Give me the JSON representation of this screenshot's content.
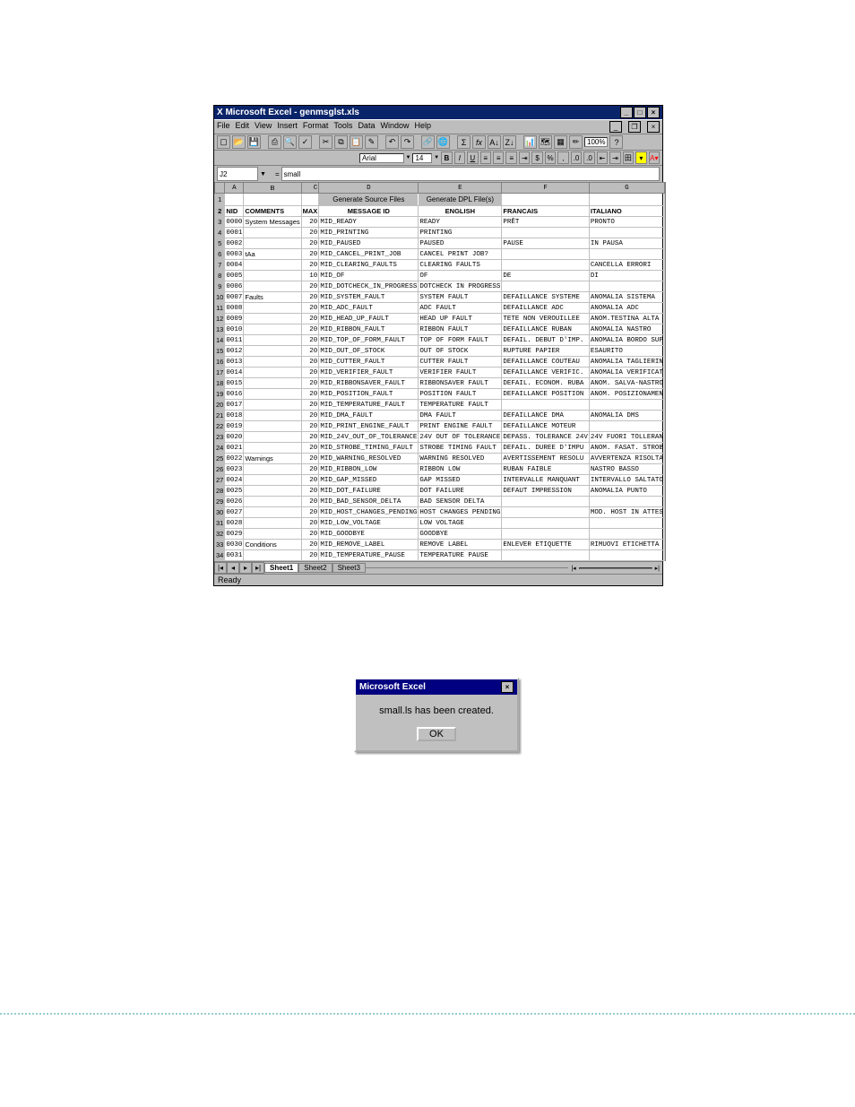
{
  "title": "Microsoft Excel - genmsglst.xls",
  "menus": [
    "File",
    "Edit",
    "View",
    "Insert",
    "Format",
    "Tools",
    "Data",
    "Window",
    "Help"
  ],
  "zoom": "100%",
  "fontname": "Arial",
  "fontsize": "14",
  "namebox": "J2",
  "formula": "small",
  "buttons": {
    "gensrc": "Generate Source Files",
    "gendpl": "Generate DPL File(s)"
  },
  "headers": {
    "nid": "NID",
    "comments": "COMMENTS",
    "max": "MAX",
    "msgid": "MESSAGE ID",
    "eng": "ENGLISH",
    "fra": "FRANCAIS",
    "ita": "ITALIANO"
  },
  "colHeaders": [
    "A",
    "B",
    "C",
    "D",
    "E",
    "F",
    "G"
  ],
  "rows": [
    {
      "n": 3,
      "a": "0000",
      "b": "System Messages",
      "c": "20",
      "d": "MID_READY",
      "e": "READY",
      "f": "PRÊT",
      "g": "PRONTO"
    },
    {
      "n": 4,
      "a": "0001",
      "b": "",
      "c": "20",
      "d": "MID_PRINTING",
      "e": "PRINTING",
      "f": "",
      "g": ""
    },
    {
      "n": 5,
      "a": "0002",
      "b": "",
      "c": "20",
      "d": "MID_PAUSED",
      "e": "PAUSED",
      "f": "PAUSE",
      "g": "IN PAUSA"
    },
    {
      "n": 6,
      "a": "0003",
      "b": "tAa",
      "c": "20",
      "d": "MID_CANCEL_PRINT_JOB",
      "e": "CANCEL PRINT JOB?",
      "f": "",
      "g": ""
    },
    {
      "n": 7,
      "a": "0004",
      "b": "",
      "c": "20",
      "d": "MID_CLEARING_FAULTS",
      "e": "CLEARING FAULTS",
      "f": "",
      "g": "CANCELLA ERRORI"
    },
    {
      "n": 8,
      "a": "0005",
      "b": "",
      "c": "10",
      "d": "MID_OF",
      "e": "OF",
      "f": "DE",
      "g": "DI"
    },
    {
      "n": 9,
      "a": "0006",
      "b": "",
      "c": "20",
      "d": "MID_DOTCHECK_IN_PROGRESS",
      "e": "DOTCHECK IN PROGRESS",
      "f": "",
      "g": ""
    },
    {
      "n": 10,
      "a": "0007",
      "b": "Faults",
      "c": "20",
      "d": "MID_SYSTEM_FAULT",
      "e": "SYSTEM FAULT",
      "f": "DEFAILLANCE SYSTEME",
      "g": "ANOMALIA SISTEMA"
    },
    {
      "n": 11,
      "a": "0008",
      "b": "",
      "c": "20",
      "d": "MID_ADC_FAULT",
      "e": "ADC FAULT",
      "f": "DEFAILLANCE ADC",
      "g": "ANOMALIA ADC"
    },
    {
      "n": 12,
      "a": "0009",
      "b": "",
      "c": "20",
      "d": "MID_HEAD_UP_FAULT",
      "e": "HEAD UP FAULT",
      "f": "TETE NON VEROUILLEE",
      "g": "ANOM.TESTINA ALTA"
    },
    {
      "n": 13,
      "a": "0010",
      "b": "",
      "c": "20",
      "d": "MID_RIBBON_FAULT",
      "e": "RIBBON FAULT",
      "f": "DEFAILLANCE RUBAN",
      "g": "ANOMALIA NASTRO"
    },
    {
      "n": 14,
      "a": "0011",
      "b": "",
      "c": "20",
      "d": "MID_TOP_OF_FORM_FAULT",
      "e": "TOP OF FORM FAULT",
      "f": "DEFAIL. DEBUT D'IMP.",
      "g": "ANOMALIA BORDO SUP"
    },
    {
      "n": 15,
      "a": "0012",
      "b": "",
      "c": "20",
      "d": "MID_OUT_OF_STOCK",
      "e": "OUT OF STOCK",
      "f": "RUPTURE PAPIER",
      "g": "ESAURITO"
    },
    {
      "n": 16,
      "a": "0013",
      "b": "",
      "c": "20",
      "d": "MID_CUTTER_FAULT",
      "e": "CUTTER FAULT",
      "f": "DEFAILLANCE COUTEAU",
      "g": "ANOMALIA TAGLIERIN"
    },
    {
      "n": 17,
      "a": "0014",
      "b": "",
      "c": "20",
      "d": "MID_VERIFIER_FAULT",
      "e": "VERIFIER FAULT",
      "f": "DEFAILLANCE VERIFIC.",
      "g": "ANOMALIA VERIFICAT"
    },
    {
      "n": 18,
      "a": "0015",
      "b": "",
      "c": "20",
      "d": "MID_RIBBONSAVER_FAULT",
      "e": "RIBBONSAVER FAULT",
      "f": "DEFAIL. ECONOM. RUBA",
      "g": "ANOM. SALVA-NASTRO"
    },
    {
      "n": 19,
      "a": "0016",
      "b": "",
      "c": "20",
      "d": "MID_POSITION_FAULT",
      "e": "POSITION FAULT",
      "f": "DEFAILLANCE POSITION",
      "g": "ANOM. POSIZIONAMEN"
    },
    {
      "n": 20,
      "a": "0017",
      "b": "",
      "c": "20",
      "d": "MID_TEMPERATURE_FAULT",
      "e": "TEMPERATURE FAULT",
      "f": "",
      "g": ""
    },
    {
      "n": 21,
      "a": "0018",
      "b": "",
      "c": "20",
      "d": "MID_DMA_FAULT",
      "e": "DMA FAULT",
      "f": "DEFAILLANCE DMA",
      "g": "ANOMALIA DMS"
    },
    {
      "n": 22,
      "a": "0019",
      "b": "",
      "c": "20",
      "d": "MID_PRINT_ENGINE_FAULT",
      "e": "PRINT ENGINE FAULT",
      "f": "DEFAILLANCE MOTEUR",
      "g": ""
    },
    {
      "n": 23,
      "a": "0020",
      "b": "",
      "c": "20",
      "d": "MID_24V_OUT_OF_TOLERANCE",
      "e": "24V OUT OF TOLERANCE",
      "f": "DEPASS. TOLERANCE 24V",
      "g": "24V FUORI TOLLERAN"
    },
    {
      "n": 24,
      "a": "0021",
      "b": "",
      "c": "20",
      "d": "MID_STROBE_TIMING_FAULT",
      "e": "STROBE TIMING FAULT",
      "f": "DEFAIL. DUREE D'IMPU",
      "g": "ANOM. FASAT. STROB"
    },
    {
      "n": 25,
      "a": "0022",
      "b": "Warnings",
      "c": "20",
      "d": "MID_WARNING_RESOLVED",
      "e": "WARNING RESOLVED",
      "f": "AVERTISSEMENT RESOLU",
      "g": "AVVERTENZA RISOLTA"
    },
    {
      "n": 26,
      "a": "0023",
      "b": "",
      "c": "20",
      "d": "MID_RIBBON_LOW",
      "e": "RIBBON LOW",
      "f": "RUBAN FAIBLE",
      "g": "NASTRO BASSO"
    },
    {
      "n": 27,
      "a": "0024",
      "b": "",
      "c": "20",
      "d": "MID_GAP_MISSED",
      "e": "GAP MISSED",
      "f": "INTERVALLE MANQUANT",
      "g": "INTERVALLO SALTATO"
    },
    {
      "n": 28,
      "a": "0025",
      "b": "",
      "c": "20",
      "d": "MID_DOT_FAILURE",
      "e": "DOT FAILURE",
      "f": "DEFAUT IMPRESSION",
      "g": "ANOMALIA PUNTO"
    },
    {
      "n": 29,
      "a": "0026",
      "b": "",
      "c": "20",
      "d": "MID_BAD_SENSOR_DELTA",
      "e": "BAD SENSOR DELTA",
      "f": "",
      "g": ""
    },
    {
      "n": 30,
      "a": "0027",
      "b": "",
      "c": "20",
      "d": "MID_HOST_CHANGES_PENDING",
      "e": "HOST CHANGES PENDING",
      "f": "",
      "g": "MOD. HOST IN ATTES"
    },
    {
      "n": 31,
      "a": "0028",
      "b": "",
      "c": "20",
      "d": "MID_LOW_VOLTAGE",
      "e": "LOW VOLTAGE",
      "f": "",
      "g": ""
    },
    {
      "n": 32,
      "a": "0029",
      "b": "",
      "c": "20",
      "d": "MID_GOODBYE",
      "e": "GOODBYE",
      "f": "",
      "g": ""
    },
    {
      "n": 33,
      "a": "0030",
      "b": "Conditions",
      "c": "20",
      "d": "MID_REMOVE_LABEL",
      "e": "REMOVE LABEL",
      "f": "ENLEVER ETIQUETTE",
      "g": "RIMUOVI ETICHETTA"
    },
    {
      "n": 34,
      "a": "0031",
      "b": "",
      "c": "20",
      "d": "MID_TEMPERATURE_PAUSE",
      "e": "TEMPERATURE PAUSE",
      "f": "",
      "g": ""
    }
  ],
  "tabs": [
    "Sheet1",
    "Sheet2",
    "Sheet3"
  ],
  "status": "Ready",
  "dialog": {
    "title": "Microsoft Excel",
    "msg": "small.ls has been created.",
    "ok": "OK"
  }
}
